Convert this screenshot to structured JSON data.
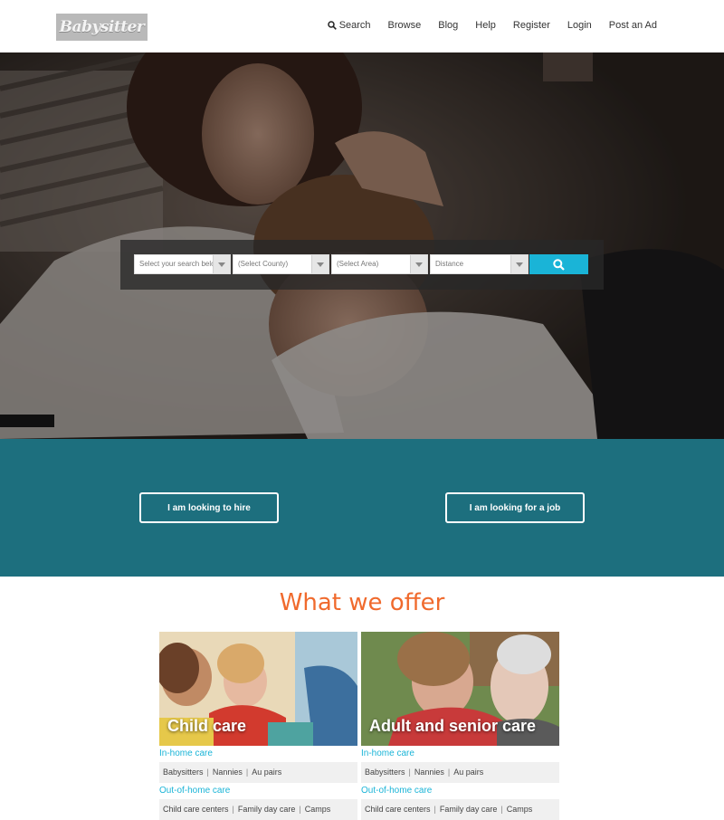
{
  "brand": {
    "logo_text": "Babysitter"
  },
  "nav": {
    "items": [
      {
        "label": "Search",
        "icon": "search-icon"
      },
      {
        "label": "Browse"
      },
      {
        "label": "Blog"
      },
      {
        "label": "Help"
      },
      {
        "label": "Register"
      },
      {
        "label": "Login"
      },
      {
        "label": "Post an Ad"
      }
    ]
  },
  "search": {
    "type_placeholder": "Select your search belo",
    "county_placeholder": "(Select County)",
    "area_placeholder": "(Select Area)",
    "distance_placeholder": "Distance",
    "button_icon": "search-icon"
  },
  "cta": {
    "hire_label": "I am looking to hire",
    "job_label": "I am looking for a job"
  },
  "offer": {
    "title": "What we offer",
    "cards": [
      {
        "caption": "Child care",
        "sections": [
          {
            "heading": "In-home care",
            "links": [
              "Babysitters",
              "Nannies",
              "Au pairs"
            ]
          },
          {
            "heading": "Out-of-home care",
            "links": [
              "Child care centers",
              "Family day care",
              "Camps"
            ]
          }
        ]
      },
      {
        "caption": "Adult and senior care",
        "sections": [
          {
            "heading": "In-home care",
            "links": [
              "Babysitters",
              "Nannies",
              "Au pairs"
            ]
          },
          {
            "heading": "Out-of-home care",
            "links": [
              "Child care centers",
              "Family day care",
              "Camps"
            ]
          }
        ]
      }
    ]
  },
  "colors": {
    "accent_cyan": "#1ab4d7",
    "teal_band": "#1d6f7e",
    "offer_title": "#f06a2d"
  }
}
